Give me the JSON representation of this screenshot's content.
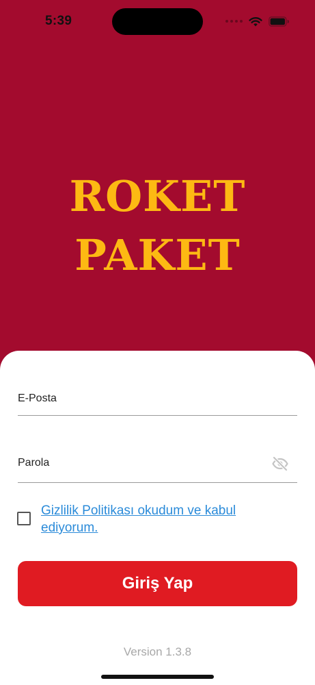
{
  "status_bar": {
    "time": "5:39",
    "icons": [
      "signal-dots-icon",
      "wifi-icon",
      "battery-icon"
    ]
  },
  "logo": {
    "line1": "ROKET",
    "line2": "PAKET",
    "color": "#FDB913"
  },
  "form": {
    "email_placeholder": "E-Posta",
    "email_value": "",
    "password_placeholder": "Parola",
    "password_value": "",
    "password_toggle_icon": "eye-off-icon",
    "policy_checked": false,
    "policy_text": "Gizlilik Politikası okudum ve kabul ediyorum.",
    "submit_label": "Giriş Yap"
  },
  "footer": {
    "version": "Version 1.3.8"
  },
  "colors": {
    "background": "#A30B2E",
    "card": "#FFFFFF",
    "button": "#E01B22",
    "link": "#2B8BD9"
  }
}
